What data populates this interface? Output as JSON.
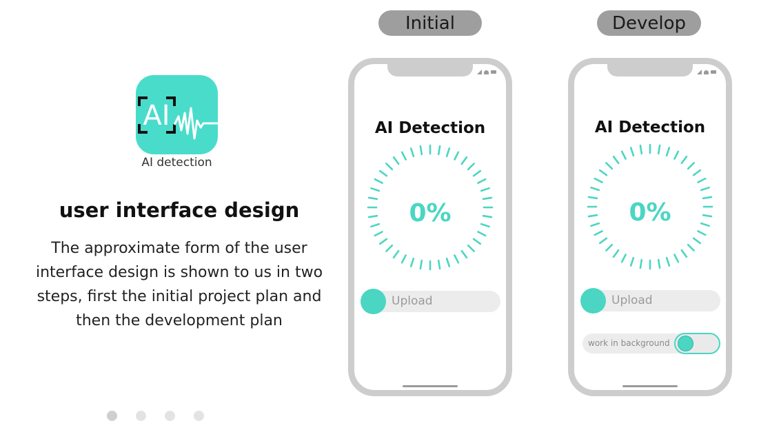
{
  "app": {
    "icon_text": "AI",
    "icon_label": "AI detection"
  },
  "intro": {
    "heading": "user interface design",
    "description": "The approximate form of the user interface design is shown to us in two steps, first the initial project plan and then the development plan"
  },
  "pager": {
    "count": 4,
    "active_index": 0
  },
  "stages": [
    {
      "label": "Initial",
      "screen": {
        "title": "AI Detection",
        "progress": "0%",
        "upload_label": "Upload"
      }
    },
    {
      "label": "Develop",
      "screen": {
        "title": "AI Detection",
        "progress": "0%",
        "upload_label": "Upload",
        "background_label": "work in background"
      }
    }
  ],
  "colors": {
    "accent": "#4ad6c3",
    "icon_bg": "#4adccb",
    "phone_frame": "#cdcdcd",
    "pill": "#9e9e9e"
  }
}
